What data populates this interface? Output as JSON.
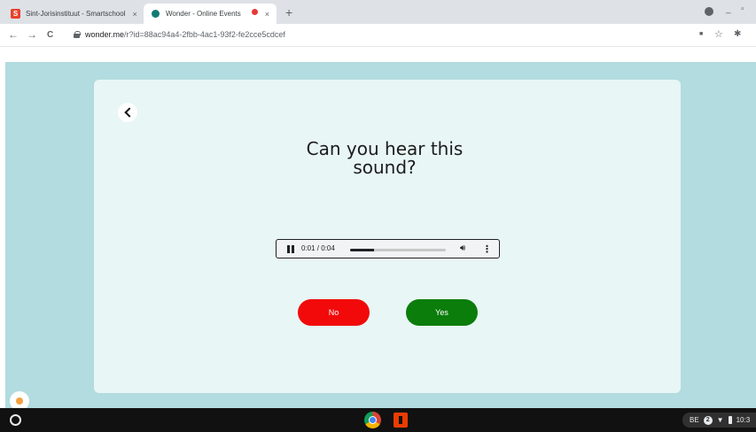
{
  "browser": {
    "tabs": [
      {
        "title": "Sint-Jorisinstituut - Smartschool",
        "favicon_letter": "S"
      },
      {
        "title": "Wonder - Online Events"
      }
    ],
    "close_glyph": "×",
    "new_tab_glyph": "+",
    "nav": {
      "back": "←",
      "forward": "→",
      "reload": "C"
    },
    "url": {
      "host": "wonder.me",
      "path": "/r?id=88ac94a4-2fbb-4ac1-93f2-fe2cce5cdcef"
    },
    "window_controls": {
      "minimize": "_",
      "restore": "▫"
    },
    "toolbar_icons": {
      "media": "■",
      "star": "☆",
      "extensions": "✱"
    }
  },
  "content": {
    "question": "Can you hear this sound?",
    "audio": {
      "time": "0:01 / 0:04",
      "progress_fraction": 0.25
    },
    "buttons": {
      "no": "No",
      "yes": "Yes"
    },
    "colors": {
      "no": "#f20a0a",
      "yes": "#0b7d0b",
      "background": "#b2dcdf",
      "card": "#e8f6f5"
    }
  },
  "shelf": {
    "tray": {
      "locale": "BE",
      "badge": "2",
      "wifi": "▼",
      "time": "10:3"
    }
  }
}
